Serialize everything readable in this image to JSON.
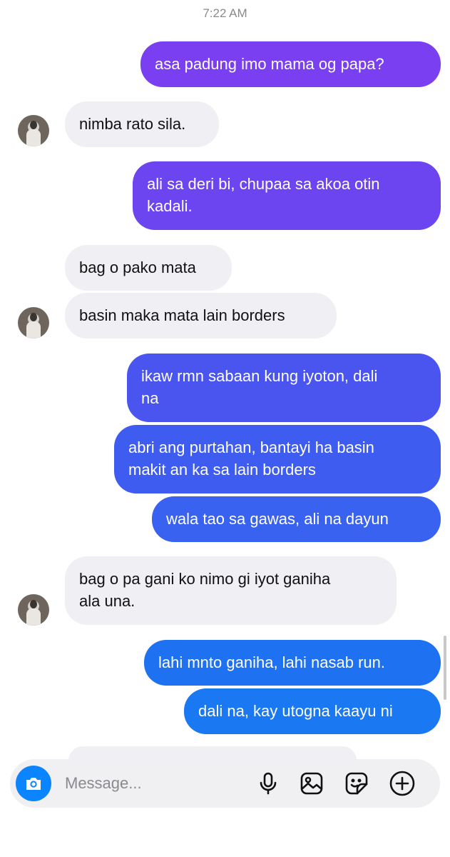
{
  "timestamp": "7:22 AM",
  "messages": [
    {
      "side": "out",
      "text": "asa padung imo mama og papa?",
      "color": "#7b3ff2"
    },
    {
      "side": "in",
      "text": "nimba rato sila."
    },
    {
      "side": "out",
      "lines": [
        "ali sa deri bi, chupaa sa akoa otin",
        "kadali."
      ],
      "color": "#6c45f0"
    },
    {
      "side": "in",
      "text": "bag o pako mata"
    },
    {
      "side": "in",
      "text": "basin maka mata lain borders"
    },
    {
      "side": "out",
      "lines": [
        "ikaw rmn sabaan kung iyoton, dali",
        "na"
      ],
      "color": "#4a55f0"
    },
    {
      "side": "out",
      "lines": [
        "abri ang purtahan, bantayi ha basin",
        "makit an ka sa lain borders"
      ],
      "color": "#3f5cf0"
    },
    {
      "side": "out",
      "text": "wala tao sa gawas, ali na dayun",
      "color": "#3a62f0"
    },
    {
      "side": "in",
      "lines": [
        "bag o pa gani ko nimo gi iyot ganiha",
        "ala una."
      ]
    },
    {
      "side": "out",
      "text": "lahi mnto ganiha, lahi nasab run.",
      "color": "#1e72f2"
    },
    {
      "side": "out",
      "text": "dali na, kay utogna kaayu ni",
      "color": "#1a78f2"
    }
  ],
  "composer": {
    "placeholder": "Message...",
    "icons": [
      "camera-icon",
      "microphone-icon",
      "gallery-icon",
      "sticker-icon",
      "add-icon"
    ],
    "camera_color": "#0a84ff"
  }
}
